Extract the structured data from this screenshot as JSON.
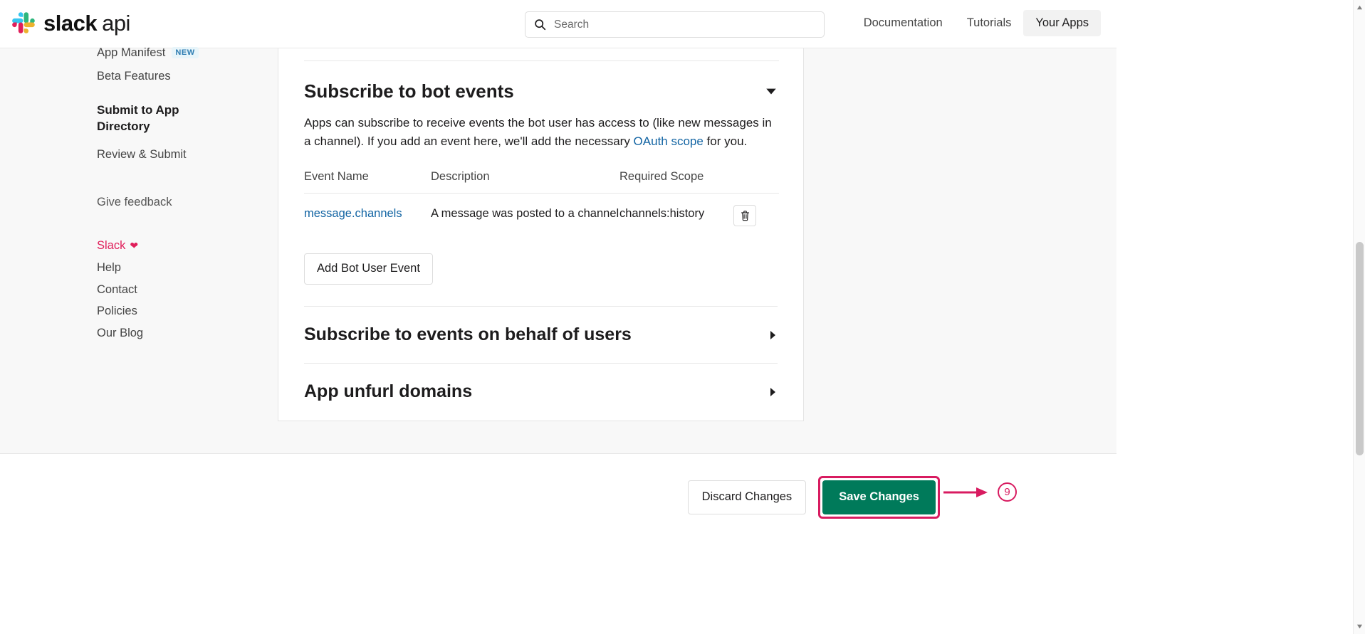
{
  "header": {
    "logo_slack": "slack",
    "logo_api": "api",
    "logo_icon": "slack-logo-icon",
    "search": {
      "placeholder": "Search",
      "value": "",
      "icon": "search-icon"
    },
    "nav": [
      {
        "label": "Documentation",
        "active": false
      },
      {
        "label": "Tutorials",
        "active": false
      },
      {
        "label": "Your Apps",
        "active": true
      }
    ]
  },
  "sidebar": {
    "app_manifest": "App Manifest",
    "app_manifest_badge": "NEW",
    "beta_features": "Beta Features",
    "submit_heading": "Submit to App Directory",
    "review_submit": "Review & Submit",
    "give_feedback": "Give feedback",
    "slack_link": "Slack",
    "heart_icon": "heart-icon",
    "footer_links": [
      "Help",
      "Contact",
      "Policies",
      "Our Blog"
    ]
  },
  "main": {
    "section_title": "Subscribe to bot events",
    "caret_icon": "chevron-down-icon",
    "description_part1": "Apps can subscribe to receive events the bot user has access to (like new messages in a channel). If you add an event here, we'll add the necessary ",
    "description_link": "OAuth scope",
    "description_part2": " for you.",
    "table": {
      "columns": [
        "Event Name",
        "Description",
        "Required Scope"
      ],
      "rows": [
        {
          "event_name": "message.channels",
          "description": "A message was posted to a channel",
          "required_scope": "channels:history",
          "delete_icon": "trash-icon"
        }
      ]
    },
    "add_event_button": "Add Bot User Event",
    "collapsed_sections": [
      {
        "title": "Subscribe to events on behalf of users",
        "icon": "chevron-right-icon"
      },
      {
        "title": "App unfurl domains",
        "icon": "chevron-right-icon"
      }
    ]
  },
  "actionbar": {
    "discard_label": "Discard Changes",
    "save_label": "Save Changes",
    "save_color": "#007a5a",
    "annotation_color": "#d81b60",
    "step_number": "9",
    "arrow_icon": "arrow-right-icon"
  }
}
